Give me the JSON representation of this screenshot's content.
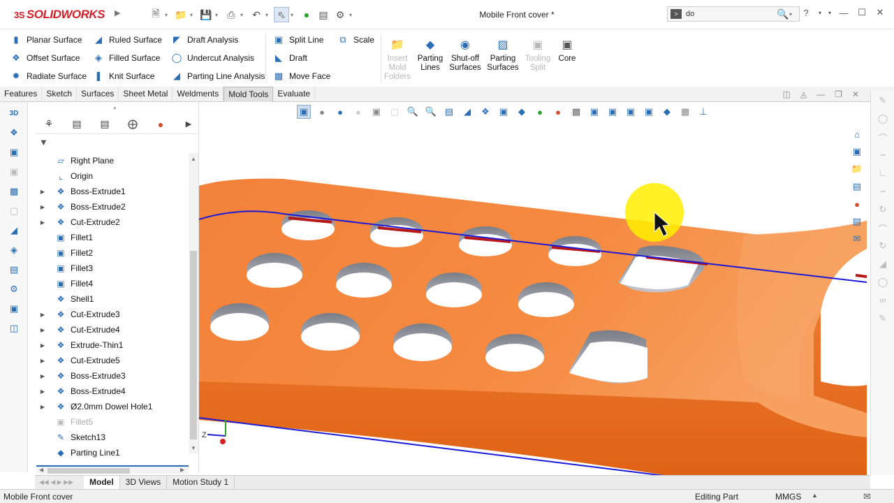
{
  "app": {
    "logo_prefix": "3S",
    "logo_text": "SOLIDWORKS",
    "document_title": "Mobile Front cover *"
  },
  "search": {
    "value": "do"
  },
  "ribbon": {
    "col1": [
      "Planar Surface",
      "Offset Surface",
      "Radiate Surface"
    ],
    "col2": [
      "Ruled Surface",
      "Filled Surface",
      "Knit Surface"
    ],
    "col3": [
      "Draft Analysis",
      "Undercut Analysis",
      "Parting Line Analysis"
    ],
    "col4": [
      "Split Line",
      "Draft",
      "Move Face"
    ],
    "scale": "Scale",
    "big": [
      {
        "label": "Insert Mold Folders",
        "disabled": true
      },
      {
        "label": "Parting Lines",
        "disabled": false
      },
      {
        "label": "Shut-off Surfaces",
        "disabled": false
      },
      {
        "label": "Parting Surfaces",
        "disabled": false
      },
      {
        "label": "Tooling Split",
        "disabled": true
      },
      {
        "label": "Core",
        "disabled": false
      }
    ]
  },
  "tabs": [
    "Features",
    "Sketch",
    "Surfaces",
    "Sheet Metal",
    "Weldments",
    "Mold Tools",
    "Evaluate"
  ],
  "tree": [
    {
      "label": "Right Plane",
      "exp": false,
      "sup": false
    },
    {
      "label": "Origin",
      "exp": false,
      "sup": false
    },
    {
      "label": "Boss-Extrude1",
      "exp": true,
      "sup": false
    },
    {
      "label": "Boss-Extrude2",
      "exp": true,
      "sup": false
    },
    {
      "label": "Cut-Extrude2",
      "exp": true,
      "sup": false
    },
    {
      "label": "Fillet1",
      "exp": false,
      "sup": false
    },
    {
      "label": "Fillet2",
      "exp": false,
      "sup": false
    },
    {
      "label": "Fillet3",
      "exp": false,
      "sup": false
    },
    {
      "label": "Fillet4",
      "exp": false,
      "sup": false
    },
    {
      "label": "Shell1",
      "exp": false,
      "sup": false
    },
    {
      "label": "Cut-Extrude3",
      "exp": true,
      "sup": false
    },
    {
      "label": "Cut-Extrude4",
      "exp": true,
      "sup": false
    },
    {
      "label": "Extrude-Thin1",
      "exp": true,
      "sup": false
    },
    {
      "label": "Cut-Extrude5",
      "exp": true,
      "sup": false
    },
    {
      "label": "Boss-Extrude3",
      "exp": true,
      "sup": false
    },
    {
      "label": "Boss-Extrude4",
      "exp": true,
      "sup": false
    },
    {
      "label": "Ø2.0mm Dowel Hole1",
      "exp": true,
      "sup": false
    },
    {
      "label": "Fillet5",
      "exp": false,
      "sup": true
    },
    {
      "label": "Sketch13",
      "exp": false,
      "sup": false
    },
    {
      "label": "Parting Line1",
      "exp": false,
      "sup": false
    }
  ],
  "bottom_tabs": [
    "Model",
    "3D Views",
    "Motion Study 1"
  ],
  "status": {
    "left": "Mobile Front cover",
    "mode": "Editing Part",
    "units": "MMGS"
  },
  "triad_axis": "Z",
  "colors": {
    "part_orange": "#f07a2a",
    "parting_line": "#1a1ad8",
    "accent": "#2a6db5"
  }
}
